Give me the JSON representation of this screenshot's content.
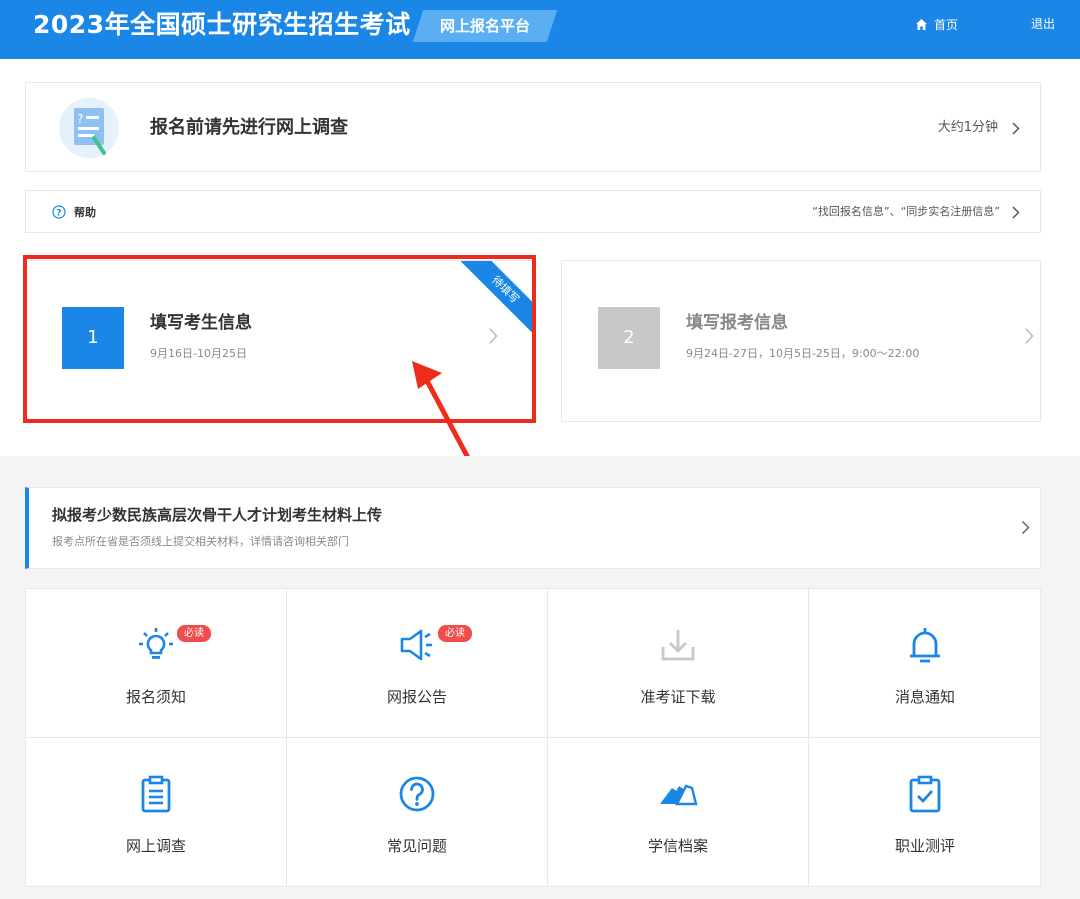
{
  "header": {
    "title": "2023年全国硕士研究生招生考试",
    "platform": "网上报名平台",
    "home": "首页",
    "logout": "退出"
  },
  "survey": {
    "text": "报名前请先进行网上调查",
    "duration": "大约1分钟"
  },
  "help": {
    "label": "帮助",
    "links": "“找回报名信息”、“同步实名注册信息”"
  },
  "steps": [
    {
      "num": "1",
      "title": "填写考生信息",
      "date": "9月16日-10月25日",
      "ribbon": "待填写"
    },
    {
      "num": "2",
      "title": "填写报考信息",
      "date": "9月24日-27日，10月5日-25日，9:00～22:00"
    }
  ],
  "minority": {
    "title": "拟报考少数民族高层次骨干人才计划考生材料上传",
    "subtitle": "报考点所在省是否须线上提交相关材料，详情请咨询相关部门"
  },
  "grid": [
    {
      "label": "报名须知",
      "badge": "必读",
      "icon": "lightbulb-icon"
    },
    {
      "label": "网报公告",
      "badge": "必读",
      "icon": "speaker-icon"
    },
    {
      "label": "准考证下载",
      "icon": "download-icon"
    },
    {
      "label": "消息通知",
      "icon": "bell-icon"
    },
    {
      "label": "网上调查",
      "icon": "clipboard-icon"
    },
    {
      "label": "常见问题",
      "icon": "question-icon"
    },
    {
      "label": "学信档案",
      "icon": "xuexin-logo-icon"
    },
    {
      "label": "职业测评",
      "icon": "clipboard-check-icon"
    }
  ],
  "colors": {
    "primary": "#1a87e6",
    "highlight": "#ee2c1c",
    "badge": "#f04d4d",
    "disabled": "#c8c8c8"
  }
}
